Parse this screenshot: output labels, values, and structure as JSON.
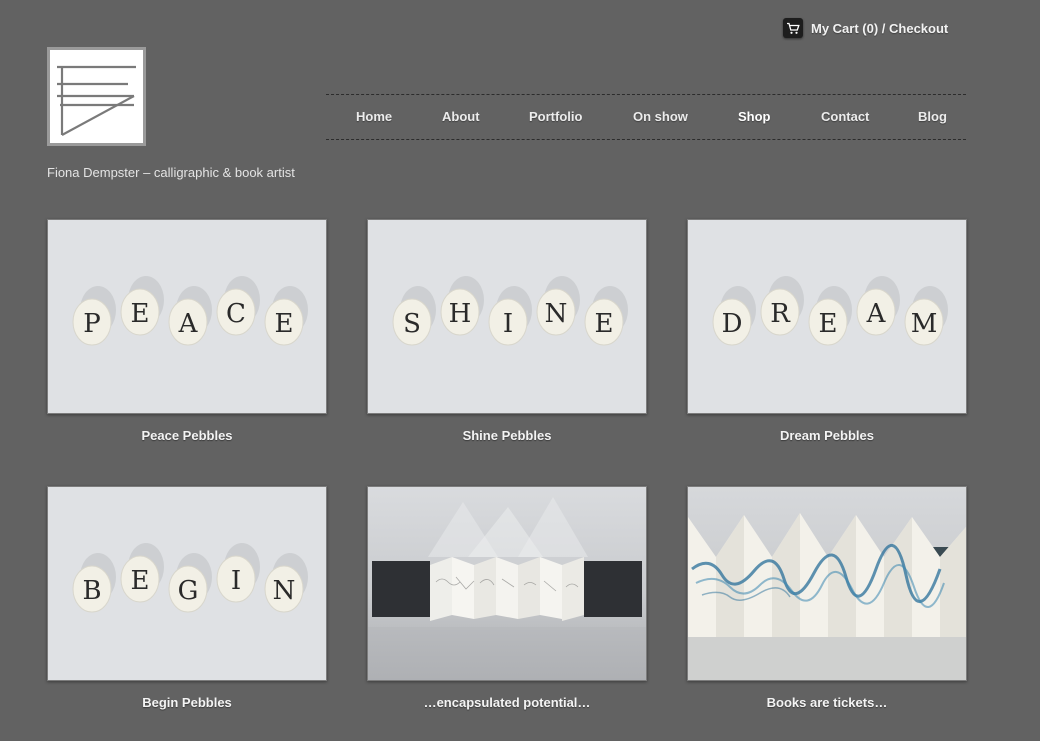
{
  "header": {
    "cart_label": "My Cart (0) / Checkout",
    "cart_icon": "shopping-cart-icon",
    "tagline": "Fiona Dempster – calligraphic & book artist"
  },
  "nav": {
    "items": [
      {
        "label": "Home"
      },
      {
        "label": "About"
      },
      {
        "label": "Portfolio"
      },
      {
        "label": "On show"
      },
      {
        "label": "Shop",
        "active": true
      },
      {
        "label": "Contact"
      },
      {
        "label": "Blog"
      }
    ]
  },
  "products": [
    {
      "title": "Peace Pebbles",
      "letters": "PEACE"
    },
    {
      "title": "Shine Pebbles",
      "letters": "SHINE"
    },
    {
      "title": "Dream Pebbles",
      "letters": "DREAM"
    },
    {
      "title": "Begin Pebbles",
      "letters": "BEGIN"
    },
    {
      "title": "…encapsulated potential…"
    },
    {
      "title": "Books are tickets…"
    }
  ],
  "colors": {
    "background": "#626262",
    "text": "#ffffff",
    "accent_ink": "#2a6f9a"
  }
}
